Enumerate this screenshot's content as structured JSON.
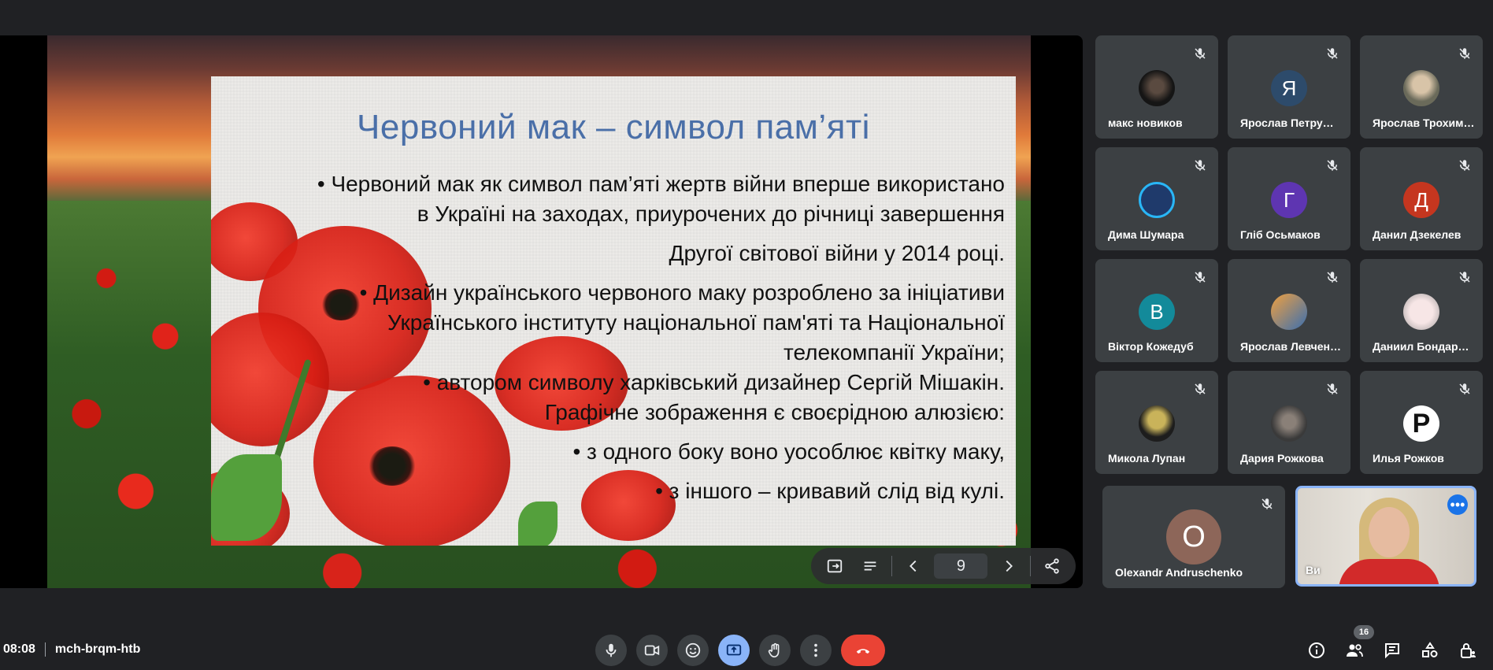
{
  "meeting": {
    "time": "08:08",
    "code": "mch-brqm-htb"
  },
  "slide": {
    "title": "Червоний мак – символ пам’яті",
    "lines": [
      "• Червоний мак як символ пам’яті жертв війни вперше використано",
      "в Україні на заходах, приурочених до річниці завершення",
      "Другої світової війни у 2014 році.",
      "•  Дизайн українського червоного маку розроблено за ініціативи",
      "Українського інституту національної пам'яті та Національної",
      "телекомпанії України;",
      "• автором символу харківський дизайнер Сергій Мішакін.",
      "Графічне зображення є своєрідною алюзією:",
      "• з одного боку воно уособлює квітку маку,",
      "• з іншого – кривавий слід від кулі."
    ],
    "page": "9"
  },
  "participants": [
    {
      "name": "макс новиков",
      "initial": "",
      "color": "#1b1b1b",
      "avatar": "photo-dark"
    },
    {
      "name": "Ярослав Петру…",
      "initial": "Я",
      "color": "#2d4b6b",
      "avatar": "letter"
    },
    {
      "name": "Ярослав Трохим…",
      "initial": "",
      "color": "#6a6a5a",
      "avatar": "photo-light"
    },
    {
      "name": "Дима Шумара",
      "initial": "",
      "color": "#1f3a6b",
      "avatar": "photo-game"
    },
    {
      "name": "Гліб Осьмаков",
      "initial": "Г",
      "color": "#5e35b1",
      "avatar": "letter"
    },
    {
      "name": "Данил Дзекелев",
      "initial": "Д",
      "color": "#c5361f",
      "avatar": "letter"
    },
    {
      "name": "Віктор Кожедуб",
      "initial": "В",
      "color": "#138a9a",
      "avatar": "letter"
    },
    {
      "name": "Ярослав Левчен…",
      "initial": "",
      "color": "#e6a24a",
      "avatar": "photo-color"
    },
    {
      "name": "Даниил Бондар…",
      "initial": "",
      "color": "#efe7e7",
      "avatar": "photo-white"
    },
    {
      "name": "Микола Лупан",
      "initial": "",
      "color": "#1d1d1d",
      "avatar": "photo-yellow"
    },
    {
      "name": "Дария Рожкова",
      "initial": "",
      "color": "#4a4a4a",
      "avatar": "photo-gray"
    },
    {
      "name": "Илья Рожков",
      "initial": "P",
      "color": "#ffffff",
      "avatar": "logo-p"
    }
  ],
  "large_participant": {
    "name": "Olexandr Andruschenko",
    "initial": "O",
    "color": "#8d6659"
  },
  "self_view": {
    "name": "Ви"
  },
  "people_count": "16",
  "colors": {
    "accent": "#8ab4f8",
    "end_call": "#ea4335",
    "tile": "#3c4043",
    "background": "#202124"
  }
}
